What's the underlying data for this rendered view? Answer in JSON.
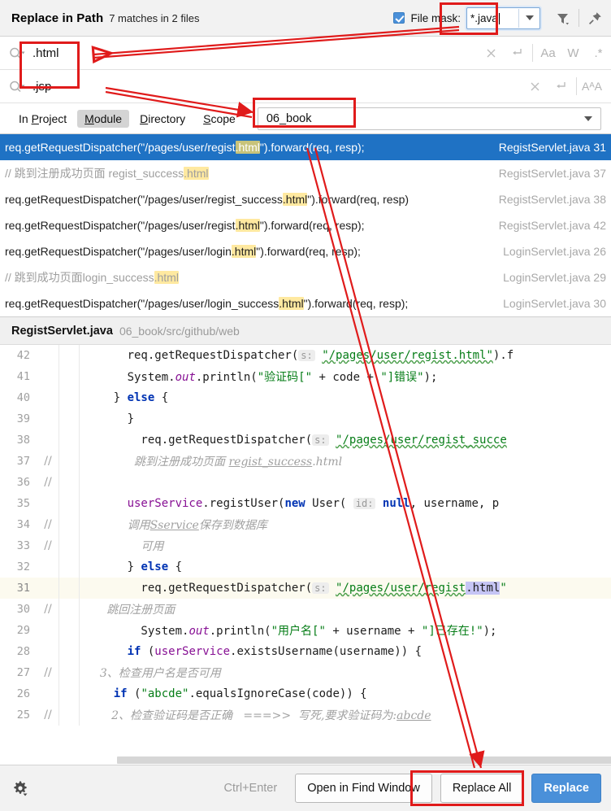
{
  "header": {
    "title": "Replace in Path",
    "summary": "7 matches in 2 files",
    "file_mask_label": "File mask:",
    "file_mask_value": "*.java",
    "filter_icon": "filter-icon",
    "pin_icon": "pin-icon"
  },
  "search": {
    "find_value": ".html",
    "replace_value": ".jsp",
    "clear_icon": "close-icon",
    "history_icon": "return-icon",
    "match_case_label": "Aa",
    "words_label": "W",
    "regex_label": ".*",
    "preserve_case_label": "AᴬA"
  },
  "scope": {
    "tabs": [
      {
        "label": "In Project",
        "prefix": "In ",
        "underlined": "P",
        "rest": "roject",
        "active": false
      },
      {
        "label": "Module",
        "prefix": "",
        "underlined": "M",
        "rest": "odule",
        "active": true
      },
      {
        "label": "Directory",
        "prefix": "",
        "underlined": "D",
        "rest": "irectory",
        "active": false
      },
      {
        "label": "Scope",
        "prefix": "",
        "underlined": "S",
        "rest": "cope",
        "active": false
      }
    ],
    "selected_module": "06_book"
  },
  "results": [
    {
      "selected": true,
      "comment": false,
      "pre": "req.getRequestDispatcher(\"/pages/user/regist",
      "match": ".html",
      "post": "\").forward(req, resp);",
      "file": "RegistServlet.java",
      "line": "31"
    },
    {
      "selected": false,
      "comment": true,
      "pre": "//        跳到注册成功页面 regist_success",
      "match": ".html",
      "post": "",
      "file": "RegistServlet.java",
      "line": "37"
    },
    {
      "selected": false,
      "comment": false,
      "pre": "req.getRequestDispatcher(\"/pages/user/regist_success",
      "match": ".html",
      "post": "\").forward(req, resp)",
      "file": "RegistServlet.java",
      "line": "38"
    },
    {
      "selected": false,
      "comment": false,
      "pre": "req.getRequestDispatcher(\"/pages/user/regist",
      "match": ".html",
      "post": "\").forward(req, resp);",
      "file": "RegistServlet.java",
      "line": "42"
    },
    {
      "selected": false,
      "comment": false,
      "pre": "req.getRequestDispatcher(\"/pages/user/login",
      "match": ".html",
      "post": "\").forward(req, resp);",
      "file": "LoginServlet.java",
      "line": "26"
    },
    {
      "selected": false,
      "comment": true,
      "pre": "//        跳到成功页面login_success",
      "match": ".html",
      "post": "",
      "file": "LoginServlet.java",
      "line": "29"
    },
    {
      "selected": false,
      "comment": false,
      "pre": "req.getRequestDispatcher(\"/pages/user/login_success",
      "match": ".html",
      "post": "\").forward(req, resp);",
      "file": "LoginServlet.java",
      "line": "30"
    }
  ],
  "preview": {
    "file_name": "RegistServlet.java",
    "file_path": "06_book/src/github/web",
    "lines": [
      {
        "no": "25",
        "current": false,
        "comment_marker": "//",
        "html": "<span class=\"com\">       2、检查验证码是否正确   ===&gt;&gt;  写死,要求验证码为:<span class=\"ul\">abcde</span></span>",
        "text": "//       2、检查验证码是否正确   ===>>  写死,要求验证码为:abcde"
      },
      {
        "no": "26",
        "current": false,
        "comment_marker": "",
        "html": "    <span class=\"kw\">if</span> (<span class=\"str\">\"abcde\"</span>.equalsIgnoreCase(code)) {",
        "text": "    if (\"abcde\".equalsIgnoreCase(code)) {"
      },
      {
        "no": "27",
        "current": false,
        "comment_marker": "//",
        "html": "  <span class=\"com\">3、检查用户名是否可用</span>",
        "text": "//  3、检查用户名是否可用"
      },
      {
        "no": "28",
        "current": false,
        "comment_marker": "",
        "html": "      <span class=\"kw\">if</span> (<span class=\"fld\">userService</span>.existsUsername(username)) {",
        "text": "      if (userService.existsUsername(username)) {"
      },
      {
        "no": "29",
        "current": false,
        "comment_marker": "",
        "html": "        System.<span class=\"fld\" style=\"font-style:italic\">out</span>.println(<span class=\"str\">\"用户名[\"</span> + username + <span class=\"str\">\"]已存在!\"</span>);",
        "text": "        System.out.println(\"用户名[\" + username + \"]已存在!\");"
      },
      {
        "no": "30",
        "current": false,
        "comment_marker": "//",
        "html": "   <span class=\"com\">跳回注册页面</span>",
        "text": "//   跳回注册页面"
      },
      {
        "no": "31",
        "current": true,
        "comment_marker": "",
        "html": "        req.getRequestDispatcher(<span class=\"hint\">s:</span> <span class=\"str squig\">\"/pages/user/regist</span><span class=\"mhl\">.html</span><span class=\"str\">\"</span>",
        "text": "        req.getRequestDispatcher( s: \"/pages/user/regist.html\""
      },
      {
        "no": "32",
        "current": false,
        "comment_marker": "",
        "html": "      } <span class=\"kw\">else</span> {",
        "text": "      } else {"
      },
      {
        "no": "33",
        "current": false,
        "comment_marker": "//",
        "html": "        <span class=\"com\">可用</span>",
        "text": "//        可用"
      },
      {
        "no": "34",
        "current": false,
        "comment_marker": "//",
        "html": "      <span class=\"com\">调用<span class=\"ul\">Sservice</span>保存到数据库</span>",
        "text": "//      调用Sservice保存到数据库"
      },
      {
        "no": "35",
        "current": false,
        "comment_marker": "",
        "html": "      <span class=\"fld\">userService</span>.registUser(<span class=\"kw\">new</span> User( <span class=\"hint\">id:</span> <span class=\"kw\">null</span>, username, p",
        "text": "      userService.registUser(new User( id: null, username, p"
      },
      {
        "no": "36",
        "current": false,
        "comment_marker": "//",
        "html": "",
        "text": "//"
      },
      {
        "no": "37",
        "current": false,
        "comment_marker": "//",
        "html": "       <span class=\"com\">跳到注册成功页面 <span class=\"ul\">regist_success</span>.html</span>",
        "text": "//       跳到注册成功页面 regist_success.html"
      },
      {
        "no": "38",
        "current": false,
        "comment_marker": "",
        "html": "        req.getRequestDispatcher(<span class=\"hint\">s:</span> <span class=\"str squig\">\"/pages/user/regist_succe</span>",
        "text": "        req.getRequestDispatcher( s: \"/pages/user/regist_succe"
      },
      {
        "no": "39",
        "current": false,
        "comment_marker": "",
        "html": "      }",
        "text": "      }"
      },
      {
        "no": "40",
        "current": false,
        "comment_marker": "",
        "html": "    } <span class=\"kw\">else</span> {",
        "text": "    } else {"
      },
      {
        "no": "41",
        "current": false,
        "comment_marker": "",
        "html": "      System.<span class=\"fld\" style=\"font-style:italic\">out</span>.println(<span class=\"str\">\"验证码[\"</span> + code + <span class=\"str\">\"]错误\"</span>);",
        "text": "      System.out.println(\"验证码[\" + code + \"]错误\");"
      },
      {
        "no": "42",
        "current": false,
        "comment_marker": "",
        "html": "      req.getRequestDispatcher(<span class=\"hint\">s:</span> <span class=\"str squig\">\"/pages/user/regist.html\"</span>).f",
        "text": "      req.getRequestDispatcher( s: \"/pages/user/regist.html\").f"
      }
    ]
  },
  "footer": {
    "shortcut": "Ctrl+Enter",
    "open_in_find_window": "Open in Find Window",
    "replace_all": "Replace All",
    "replace": "Replace",
    "gear_icon": "gear-icon"
  },
  "colors": {
    "accent": "#4a90d9",
    "selection": "#1f72c4",
    "highlight": "#ffe9a0",
    "annotation": "#e01b1b"
  }
}
